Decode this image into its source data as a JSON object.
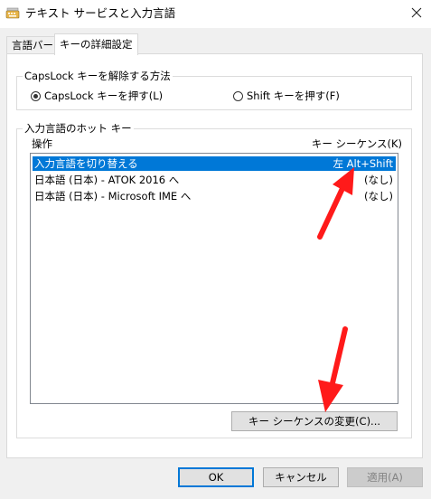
{
  "window": {
    "title": "テキスト サービスと入力言語",
    "icon": "keyboard-icon",
    "close_icon": "close-icon"
  },
  "tabs": [
    {
      "label": "言語バー",
      "active": false
    },
    {
      "label": "キーの詳細設定",
      "active": true
    }
  ],
  "capslock_group": {
    "legend": "CapsLock キーを解除する方法",
    "options": [
      {
        "label": "CapsLock キーを押す(L)",
        "selected": true
      },
      {
        "label": "Shift キーを押す(F)",
        "selected": false
      }
    ]
  },
  "hotkeys_group": {
    "legend": "入力言語のホット キー",
    "columns": {
      "action": "操作",
      "sequence": "キー シーケンス(K)"
    },
    "rows": [
      {
        "action": "入力言語を切り替える",
        "sequence": "左 Alt+Shift",
        "selected": true
      },
      {
        "action": "日本語 (日本) - ATOK 2016 へ",
        "sequence": "(なし)",
        "selected": false
      },
      {
        "action": "日本語 (日本) - Microsoft IME へ",
        "sequence": "(なし)",
        "selected": false
      }
    ],
    "change_button": "キー シーケンスの変更(C)..."
  },
  "footer": {
    "ok": "OK",
    "cancel": "キャンセル",
    "apply": "適用(A)"
  },
  "colors": {
    "selection": "#0078d7",
    "annotation_arrow": "#ff1a1a"
  }
}
